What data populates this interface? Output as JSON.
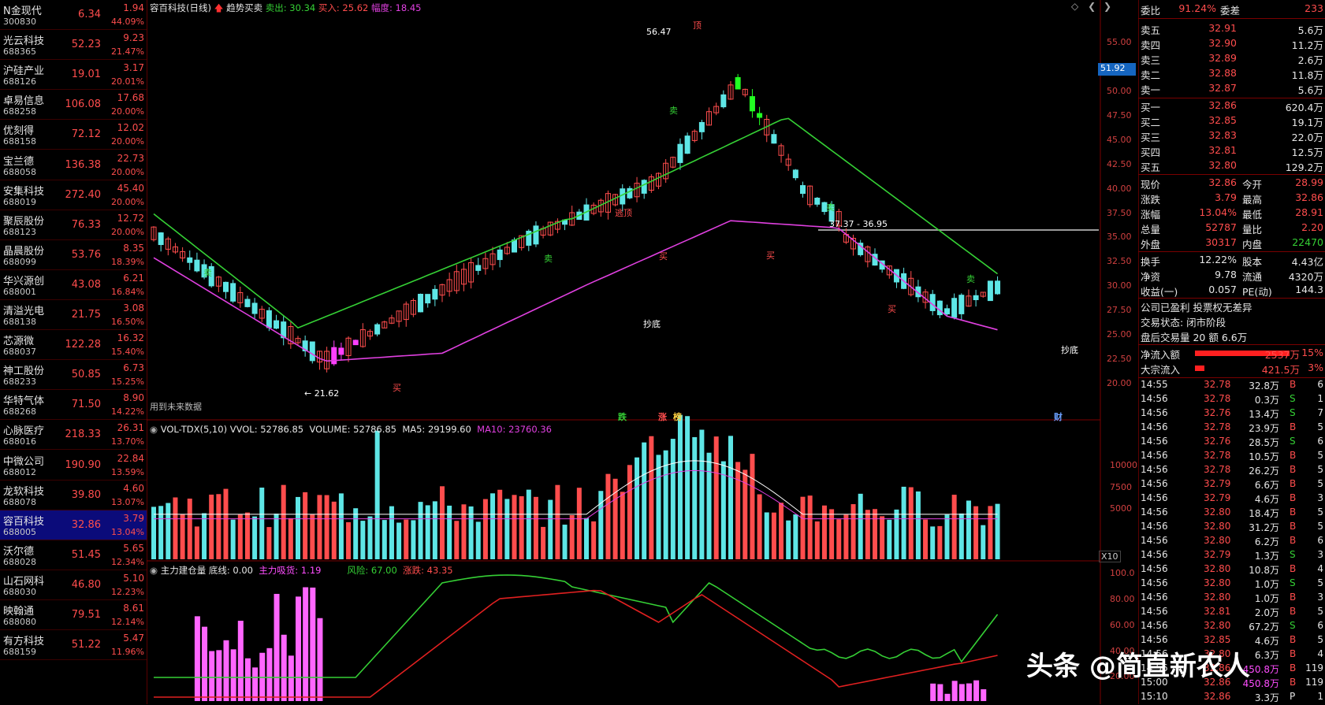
{
  "watchlist": [
    {
      "name": "N金现代",
      "code": "300830",
      "price": "6.34",
      "change": "1.94",
      "pct": "44.09%"
    },
    {
      "name": "光云科技",
      "code": "688365",
      "price": "52.23",
      "change": "9.23",
      "pct": "21.47%"
    },
    {
      "name": "沪硅产业",
      "code": "688126",
      "price": "19.01",
      "change": "3.17",
      "pct": "20.01%"
    },
    {
      "name": "卓易信息",
      "code": "688258",
      "price": "106.08",
      "change": "17.68",
      "pct": "20.00%"
    },
    {
      "name": "优刻得",
      "code": "688158",
      "price": "72.12",
      "change": "12.02",
      "pct": "20.00%"
    },
    {
      "name": "宝兰德",
      "code": "688058",
      "price": "136.38",
      "change": "22.73",
      "pct": "20.00%"
    },
    {
      "name": "安集科技",
      "code": "688019",
      "price": "272.40",
      "change": "45.40",
      "pct": "20.00%"
    },
    {
      "name": "聚辰股份",
      "code": "688123",
      "price": "76.33",
      "change": "12.72",
      "pct": "20.00%"
    },
    {
      "name": "晶晨股份",
      "code": "688099",
      "price": "53.76",
      "change": "8.35",
      "pct": "18.39%"
    },
    {
      "name": "华兴源创",
      "code": "688001",
      "price": "43.08",
      "change": "6.21",
      "pct": "16.84%"
    },
    {
      "name": "清溢光电",
      "code": "688138",
      "price": "21.75",
      "change": "3.08",
      "pct": "16.50%"
    },
    {
      "name": "芯源微",
      "code": "688037",
      "price": "122.28",
      "change": "16.32",
      "pct": "15.40%"
    },
    {
      "name": "神工股份",
      "code": "688233",
      "price": "50.85",
      "change": "6.73",
      "pct": "15.25%"
    },
    {
      "name": "华特气体",
      "code": "688268",
      "price": "71.50",
      "change": "8.90",
      "pct": "14.22%"
    },
    {
      "name": "心脉医疗",
      "code": "688016",
      "price": "218.33",
      "change": "26.31",
      "pct": "13.70%"
    },
    {
      "name": "中微公司",
      "code": "688012",
      "price": "190.90",
      "change": "22.84",
      "pct": "13.59%"
    },
    {
      "name": "龙软科技",
      "code": "688078",
      "price": "39.80",
      "change": "4.60",
      "pct": "13.07%"
    },
    {
      "name": "容百科技",
      "code": "688005",
      "price": "32.86",
      "change": "3.79",
      "pct": "13.04%",
      "selected": true
    },
    {
      "name": "沃尔德",
      "code": "688028",
      "price": "51.45",
      "change": "5.65",
      "pct": "12.34%"
    },
    {
      "name": "山石网科",
      "code": "688030",
      "price": "46.80",
      "change": "5.10",
      "pct": "12.23%"
    },
    {
      "name": "映翰通",
      "code": "688080",
      "price": "79.51",
      "change": "8.61",
      "pct": "12.14%"
    },
    {
      "name": "有方科技",
      "code": "688159",
      "price": "51.22",
      "change": "5.47",
      "pct": "11.96%"
    }
  ],
  "main_panel": {
    "stock_title": "容百科技(日线)",
    "indicator_name": "趋势买卖",
    "sell_label": "卖出: 30.34",
    "buy_label": "买入: 25.62",
    "amplitude_label": "幅度: 18.45",
    "current_price_tag": "51.92",
    "axis_ticks": [
      "55.00",
      "52.50",
      "50.00",
      "47.50",
      "45.00",
      "42.50",
      "40.00",
      "37.50",
      "35.00",
      "32.50",
      "30.00",
      "27.50",
      "25.00",
      "22.50",
      "20.00"
    ],
    "high_label": "56.47",
    "low_label": "← 21.62",
    "range_label": "37.37 - 36.95",
    "future_data_note": "用到未来数据",
    "bottom_markers": [
      "跌",
      "涨",
      "榜",
      "财"
    ],
    "sell_tag": "卖",
    "buy_tag": "买",
    "top_tag": "顶",
    "escape_tag": "逃顶",
    "bottom_tag": "抄底"
  },
  "volume_panel": {
    "name": "VOL-TDX(5,10)",
    "vvol": "VVOL: 52786.85",
    "volume": "VOLUME: 52786.85",
    "ma5": "MA5: 29199.60",
    "ma10": "MA10: 23760.36",
    "axis_ticks": [
      "10000",
      "7500",
      "5000"
    ],
    "unit": "X10"
  },
  "indicator_panel": {
    "name": "主力建仓量",
    "base_line": "底线: 0.00",
    "main_suction": "主力吸货: 1.19",
    "risk": "风险: 67.00",
    "rise_fall": "涨跌: 43.35",
    "axis_ticks": [
      "100.0",
      "80.00",
      "60.00",
      "40.00",
      "20.00"
    ]
  },
  "quote": {
    "wei_bi_label": "委比",
    "wei_bi": "91.24%",
    "wei_cha_label": "委差",
    "wei_cha": "233",
    "asks": [
      {
        "label": "卖五",
        "price": "32.91",
        "vol": "5.6万"
      },
      {
        "label": "卖四",
        "price": "32.90",
        "vol": "11.2万"
      },
      {
        "label": "卖三",
        "price": "32.89",
        "vol": "2.6万"
      },
      {
        "label": "卖二",
        "price": "32.88",
        "vol": "11.8万"
      },
      {
        "label": "卖一",
        "price": "32.87",
        "vol": "5.6万"
      }
    ],
    "bids": [
      {
        "label": "买一",
        "price": "32.86",
        "vol": "620.4万"
      },
      {
        "label": "买二",
        "price": "32.85",
        "vol": "19.1万"
      },
      {
        "label": "买三",
        "price": "32.83",
        "vol": "22.0万"
      },
      {
        "label": "买四",
        "price": "32.81",
        "vol": "12.5万"
      },
      {
        "label": "买五",
        "price": "32.80",
        "vol": "129.2万"
      }
    ],
    "stats": [
      {
        "l1": "现价",
        "v1": "32.86",
        "l2": "今开",
        "v2": "28.99",
        "c2": "#ff4d4d"
      },
      {
        "l1": "涨跌",
        "v1": "3.79",
        "l2": "最高",
        "v2": "32.86",
        "c2": "#ff4d4d"
      },
      {
        "l1": "涨幅",
        "v1": "13.04%",
        "l2": "最低",
        "v2": "28.91",
        "c2": "#ff4d4d"
      },
      {
        "l1": "总量",
        "v1": "52787",
        "l2": "量比",
        "v2": "2.20",
        "c2": "#ff4d4d"
      },
      {
        "l1": "外盘",
        "v1": "30317",
        "l2": "内盘",
        "v2": "22470",
        "c2": "#35d035"
      }
    ],
    "fund": [
      {
        "l1": "换手",
        "v1": "12.22%",
        "l2": "股本",
        "v2": "4.43亿"
      },
      {
        "l1": "净资",
        "v1": "9.78",
        "l2": "流通",
        "v2": "4320万"
      },
      {
        "l1": "收益(一)",
        "v1": "0.057",
        "l2": "PE(动)",
        "v2": "144.3"
      }
    ],
    "notes": [
      "公司已盈利 投票权无差异",
      "交易状态: 闭市阶段",
      "盘后交易量 20 额 6.6万"
    ],
    "netflow": {
      "label": "净流入额",
      "amount": "2537万",
      "pct": "15%"
    },
    "blockflow": {
      "label": "大宗流入",
      "amount": "421.5万",
      "pct": "3%"
    },
    "ticks": [
      [
        "14:55",
        "32.78",
        "32.8万",
        "B",
        "6"
      ],
      [
        "14:56",
        "32.78",
        "0.3万",
        "S",
        "1"
      ],
      [
        "14:56",
        "32.76",
        "13.4万",
        "S",
        "7"
      ],
      [
        "14:56",
        "32.78",
        "23.9万",
        "B",
        "5"
      ],
      [
        "14:56",
        "32.76",
        "28.5万",
        "S",
        "6"
      ],
      [
        "14:56",
        "32.78",
        "10.5万",
        "B",
        "5"
      ],
      [
        "14:56",
        "32.78",
        "26.2万",
        "B",
        "5"
      ],
      [
        "14:56",
        "32.79",
        "6.6万",
        "B",
        "5"
      ],
      [
        "14:56",
        "32.79",
        "4.6万",
        "B",
        "3"
      ],
      [
        "14:56",
        "32.80",
        "18.4万",
        "B",
        "5"
      ],
      [
        "14:56",
        "32.80",
        "31.2万",
        "B",
        "5"
      ],
      [
        "14:56",
        "32.80",
        "6.2万",
        "B",
        "6"
      ],
      [
        "14:56",
        "32.79",
        "1.3万",
        "S",
        "3"
      ],
      [
        "14:56",
        "32.80",
        "10.8万",
        "B",
        "4"
      ],
      [
        "14:56",
        "32.80",
        "1.0万",
        "S",
        "5"
      ],
      [
        "14:56",
        "32.80",
        "1.0万",
        "B",
        "3"
      ],
      [
        "14:56",
        "32.81",
        "2.0万",
        "B",
        "5"
      ],
      [
        "14:56",
        "32.80",
        "67.2万",
        "S",
        "6"
      ],
      [
        "14:56",
        "32.85",
        "4.6万",
        "B",
        "5"
      ],
      [
        "14:56",
        "32.80",
        "6.3万",
        "B",
        "4"
      ],
      [
        "14:56",
        "32.86",
        "450.8万",
        "B",
        "119"
      ],
      [
        "15:00",
        "32.86",
        "450.8万",
        "B",
        "119"
      ],
      [
        "15:10",
        "32.86",
        "3.3万",
        "P",
        "1"
      ]
    ]
  },
  "watermark": "头条 @简直新农人",
  "colors": {
    "up": "#ff4d4d",
    "down": "#5ee6e6",
    "ma_green": "#35d035",
    "ma_magenta": "#e040e0",
    "bg": "#000000"
  }
}
